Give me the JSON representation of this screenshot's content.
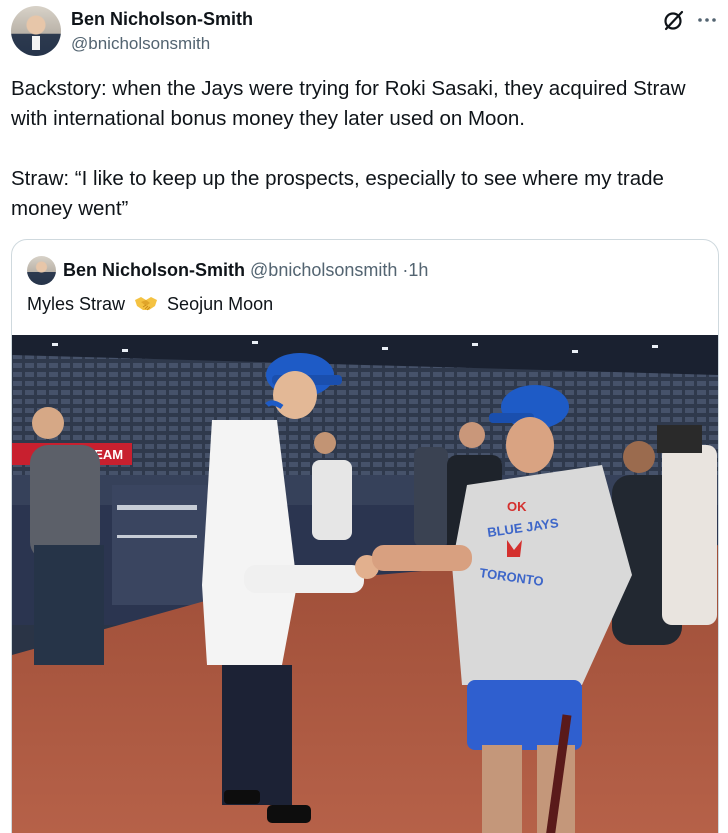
{
  "author": {
    "name": "Ben Nicholson-Smith",
    "handle": "@bnicholsonsmith"
  },
  "tweet": {
    "text": "Backstory: when the Jays were trying for Roki Sasaki, they acquired Straw with international bonus money they later used on Moon.\n\nStraw: “I like to keep up the prospects, especially to see where my trade money went”"
  },
  "icons": {
    "grok": "grok-icon",
    "more": "more-icon",
    "handshake": "handshake-icon"
  },
  "quote": {
    "name": "Ben Nicholson-Smith",
    "handle": "@bnicholsonsmith",
    "separator": "·",
    "time": "1h",
    "text_left": "Myles Straw",
    "text_right": "Seojun Moon"
  },
  "photo": {
    "banner_text": "S TEAM",
    "shirt_text_top": "OK",
    "shirt_text_mid": "BLUE JAYS",
    "shirt_text_bottom": "TORONTO"
  },
  "colors": {
    "text": "#0f1419",
    "secondary": "#536471",
    "border": "#cfd9de",
    "field_dirt": "#b0573f",
    "jays_blue": "#1e5bc6"
  }
}
